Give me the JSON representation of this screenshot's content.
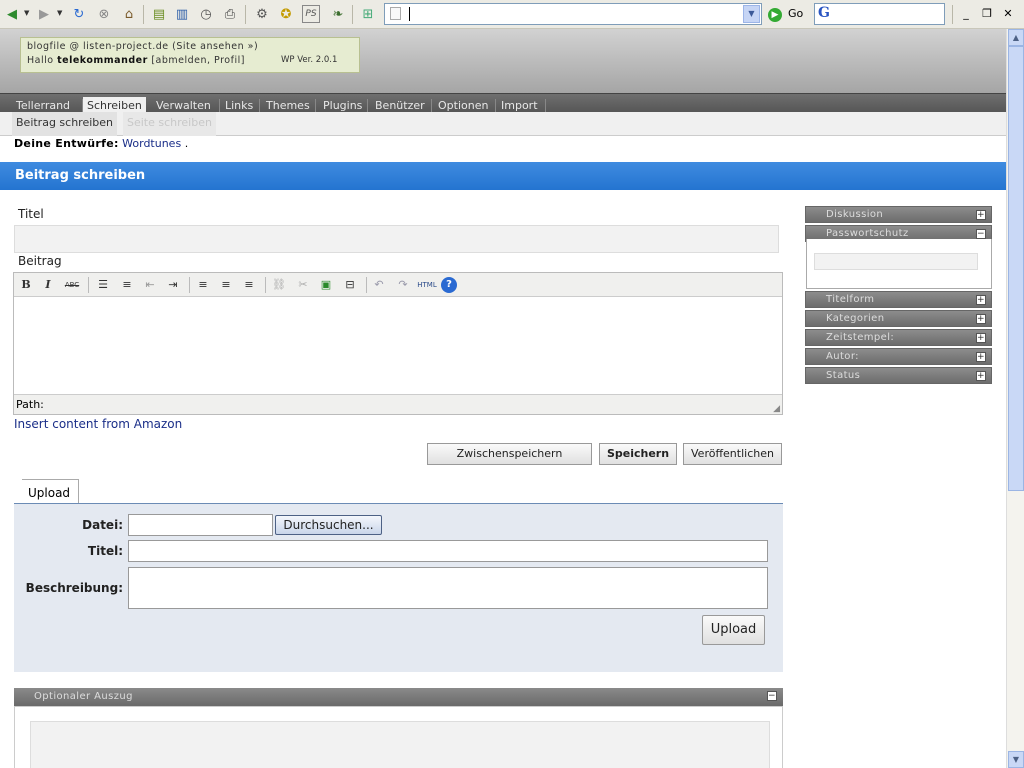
{
  "browser": {
    "url": "",
    "go_label": "Go",
    "search_logo": "G"
  },
  "header": {
    "site_line": "blogfile @ listen-project.de (Site ansehen »)",
    "greeting": "Hallo",
    "username": "telekommander",
    "user_links": "[abmelden, Profil]",
    "wp_version": "WP Ver. 2.0.1"
  },
  "menu": {
    "items": [
      "Tellerrand",
      "Schreiben",
      "Verwalten",
      "Links",
      "Themes",
      "Plugins",
      "Benützer",
      "Optionen",
      "Import"
    ],
    "active": "Schreiben"
  },
  "submenu": {
    "items": [
      "Beitrag schreiben",
      "Seite schreiben"
    ]
  },
  "drafts": {
    "label": "Deine Entwürfe:",
    "link": "Wordtunes",
    "suffix": "."
  },
  "main": {
    "heading": "Beitrag schreiben",
    "title_label": "Titel",
    "title_value": "",
    "post_label": "Beitrag",
    "path_label": "Path:",
    "amazon_link": "Insert content from Amazon",
    "buttons": {
      "save_draft": "Zwischenspeichern",
      "save": "Speichern",
      "publish": "Veröffentlichen"
    },
    "editor_toolbar": {
      "bold": "B",
      "italic": "I",
      "strike": "ABC",
      "html": "HTML"
    }
  },
  "upload": {
    "tab": "Upload",
    "file_label": "Datei:",
    "browse_button": "Durchsuchen...",
    "title_label": "Titel:",
    "desc_label": "Beschreibung:",
    "upload_button": "Upload"
  },
  "excerpt": {
    "heading": "Optionaler Auszug"
  },
  "sidebar": {
    "panels": [
      {
        "label": "Diskussion",
        "toggle": "+"
      },
      {
        "label": "Passwortschutz",
        "toggle": "−"
      },
      {
        "label": "Titelform",
        "toggle": "+"
      },
      {
        "label": "Kategorien",
        "toggle": "+"
      },
      {
        "label": "Zeitstempel:",
        "toggle": "+"
      },
      {
        "label": "Autor:",
        "toggle": "+"
      },
      {
        "label": "Status",
        "toggle": "+"
      }
    ]
  },
  "icons": {
    "back": "back-arrow-icon",
    "forward": "forward-arrow-icon",
    "reload": "reload-icon",
    "stop": "stop-icon",
    "home": "home-icon",
    "print": "print-icon",
    "history": "history-icon"
  },
  "colors": {
    "blue_bar": "#2d7fdb",
    "menu_bg": "#5f5f5f",
    "upload_panel": "#e4e9f1",
    "info_box": "#e6ecd1"
  }
}
